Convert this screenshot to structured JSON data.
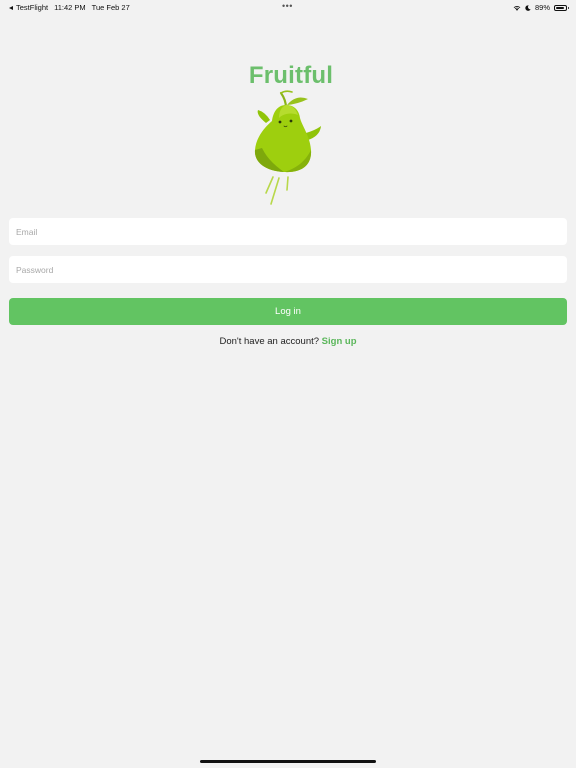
{
  "status_bar": {
    "back_app": "TestFlight",
    "time": "11:42 PM",
    "date": "Tue Feb 27",
    "multitask_dots": "•••",
    "battery_percent": "89%",
    "battery_level": 0.89,
    "icons": [
      "back-arrow-icon",
      "wifi-icon",
      "moon-icon",
      "battery-icon"
    ]
  },
  "app": {
    "title": "Fruitful",
    "mascot": "pear-mascot-icon",
    "brand_color": "#6cbf6c"
  },
  "form": {
    "email_placeholder": "Email",
    "email_value": "",
    "password_placeholder": "Password",
    "password_value": "",
    "login_label": "Log in",
    "button_color": "#62c462"
  },
  "signup": {
    "prompt": "Don't have an account?",
    "link_label": "Sign up"
  }
}
